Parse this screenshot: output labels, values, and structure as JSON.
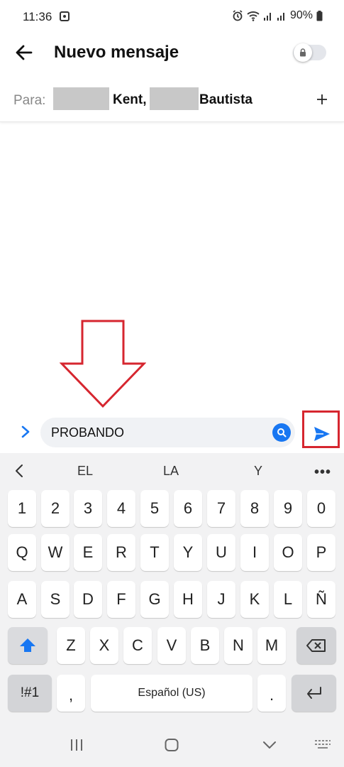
{
  "status_bar": {
    "time": "11:36",
    "battery": "90%"
  },
  "header": {
    "title": "Nuevo mensaje"
  },
  "recipients": {
    "label": "Para:",
    "names": [
      "Kent,",
      "Bautista"
    ]
  },
  "composer": {
    "message_text": "PROBANDO"
  },
  "keyboard": {
    "suggestions": [
      "EL",
      "LA",
      "Y"
    ],
    "number_row": [
      "1",
      "2",
      "3",
      "4",
      "5",
      "6",
      "7",
      "8",
      "9",
      "0"
    ],
    "row1": [
      "Q",
      "W",
      "E",
      "R",
      "T",
      "Y",
      "U",
      "I",
      "O",
      "P"
    ],
    "row2": [
      "A",
      "S",
      "D",
      "F",
      "G",
      "H",
      "J",
      "K",
      "L",
      "Ñ"
    ],
    "row3": [
      "Z",
      "X",
      "C",
      "V",
      "B",
      "N",
      "M"
    ],
    "symbols_label": "!#1",
    "comma": ",",
    "space_label": "Español (US)",
    "period": "."
  },
  "colors": {
    "accent": "#1877f2",
    "highlight": "#d6262f",
    "keyboard_bg": "#f2f2f3"
  }
}
